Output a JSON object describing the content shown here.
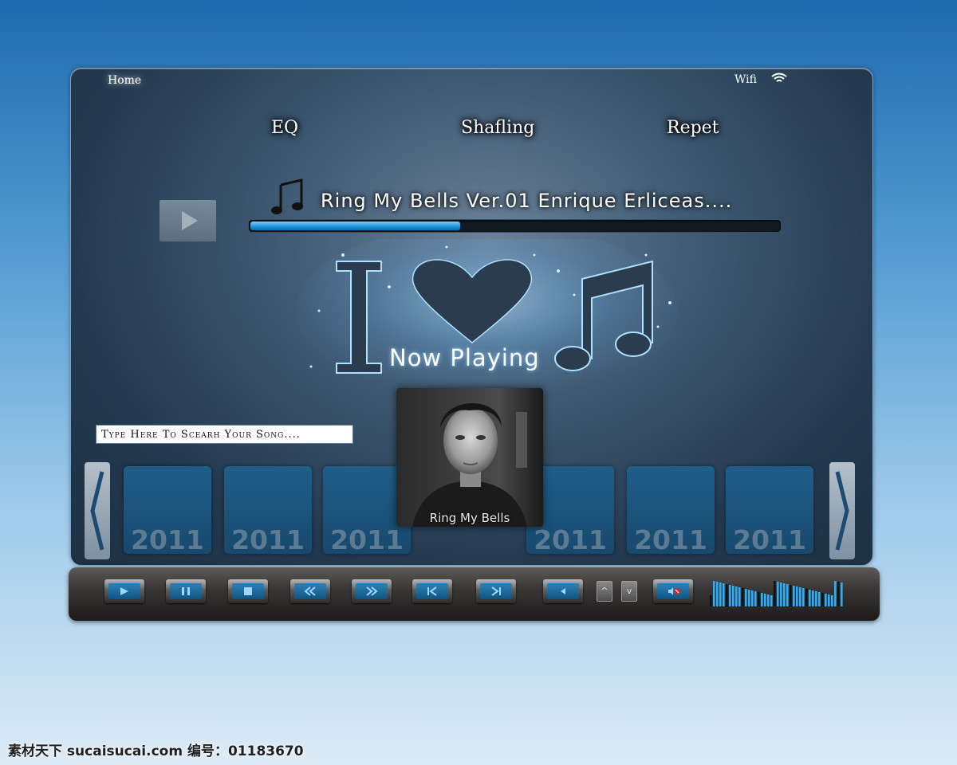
{
  "header": {
    "home_label": "Home",
    "wifi_label": "Wifi"
  },
  "modes": {
    "eq": "EQ",
    "shuffle": "Shafling",
    "repeat": "Repet"
  },
  "track": {
    "title": "Ring My Bells Ver.01 Enrique Erliceas....",
    "progress_fraction": 0.4
  },
  "now_playing_label": "Now Playing",
  "search": {
    "placeholder": "Type Here To Scearh Your Song...."
  },
  "carousel": {
    "tiles": [
      "2011",
      "2011",
      "2011",
      "2011",
      "2011",
      "2011"
    ],
    "current_album_caption": "Ring My Bells"
  },
  "controls": {
    "buttons": [
      "play-icon",
      "pause-icon",
      "stop-icon",
      "rewind-icon",
      "fast-forward-icon",
      "skip-back-icon",
      "skip-forward-icon",
      "volume-down-icon",
      "volume-up-arrow",
      "volume-down-arrow",
      "mute-icon"
    ],
    "volume_up_glyph": "^",
    "volume_down_glyph": "v"
  },
  "colors": {
    "accent": "#1b8fd5",
    "panel": "#2a435a",
    "background": "#4e97cf"
  },
  "watermark": "素材天下 sucaisucai.com  编号：01183670"
}
